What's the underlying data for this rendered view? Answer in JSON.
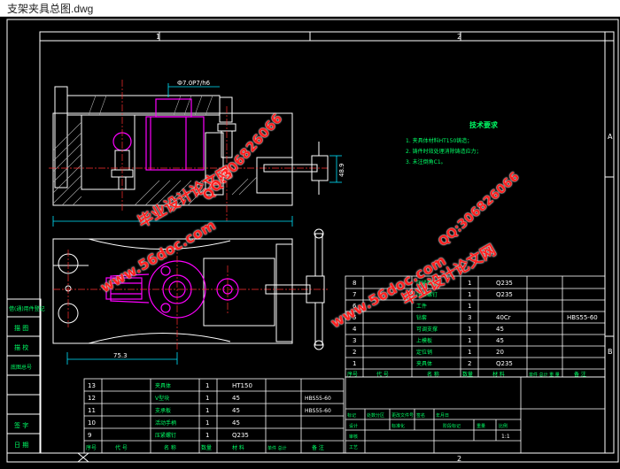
{
  "window": {
    "title": "支架夹具总图.dwg"
  },
  "drawing": {
    "zone_top_1": "1",
    "zone_top_2": "2",
    "zone_bottom_2": "2",
    "zone_right_a": "A",
    "zone_right_b": "B",
    "dim_fit": "Ф7.0P7/h6",
    "dim_height": "48.9",
    "dim_length": "75.3",
    "tech_title": "技术要求",
    "tech_items": [
      "1. 夹具体材料HT150铸造；",
      "2. 铸件时效处理消除铸造应力；",
      "3. 未注倒角C1。"
    ],
    "left_labels": [
      "借(通)用件登记",
      "描 图",
      "描 校",
      "底图总号",
      "签 字",
      "日 期"
    ]
  },
  "parts_upper": {
    "rows": [
      {
        "no": "8",
        "code": "",
        "name": "压紧螺母",
        "qty": "1",
        "material": "Q235",
        "note": ""
      },
      {
        "no": "7",
        "code": "",
        "name": "压紧螺钉",
        "qty": "1",
        "material": "Q235",
        "note": ""
      },
      {
        "no": "6",
        "code": "",
        "name": "工件",
        "qty": "1",
        "material": "",
        "note": ""
      },
      {
        "no": "5",
        "code": "",
        "name": "钻套",
        "qty": "3",
        "material": "40Cr",
        "note": "HBS55-60"
      },
      {
        "no": "4",
        "code": "",
        "name": "可调支撑",
        "qty": "1",
        "material": "45",
        "note": ""
      },
      {
        "no": "3",
        "code": "",
        "name": "上模板",
        "qty": "1",
        "material": "45",
        "note": ""
      },
      {
        "no": "2",
        "code": "",
        "name": "定位销",
        "qty": "1",
        "material": "20",
        "note": ""
      },
      {
        "no": "1",
        "code": "",
        "name": "夹具体",
        "qty": "2",
        "material": "Q235",
        "note": ""
      }
    ],
    "header": {
      "no": "序号",
      "code": "代 号",
      "name": "名 称",
      "qty": "数量",
      "material": "材 料",
      "weight": "单件 总计 重 量",
      "note": "备 注"
    }
  },
  "parts_lower": {
    "rows": [
      {
        "no": "13",
        "name": "夹具体",
        "qty": "1",
        "material": "HT150",
        "note": ""
      },
      {
        "no": "12",
        "name": "V型块",
        "qty": "1",
        "material": "45",
        "note": "HBS55-60"
      },
      {
        "no": "11",
        "name": "支承板",
        "qty": "1",
        "material": "45",
        "note": "HBS55-60"
      },
      {
        "no": "10",
        "name": "活动手柄",
        "qty": "1",
        "material": "45",
        "note": ""
      },
      {
        "no": "9",
        "name": "压紧螺钉",
        "qty": "1",
        "material": "Q235",
        "note": ""
      }
    ],
    "header": {
      "no": "序号",
      "code": "代 号",
      "name": "名 称",
      "qty": "数量",
      "material": "材 料",
      "weight": "单件 总计",
      "note": "备 注"
    }
  },
  "title_block": {
    "mark": "标记",
    "count": "处数",
    "zone": "分区",
    "change_doc": "更改文件号",
    "signature": "签名",
    "date": "年月日",
    "design": "设计",
    "standard": "标准化",
    "stage": "阶段标记",
    "weight": "重量",
    "scale": "比例",
    "scale_value": "1:1",
    "review": "审核",
    "process": "工艺"
  },
  "watermarks": [
    {
      "text": "毕业设计论文网",
      "color": "#ff2020"
    },
    {
      "text": "www.56doc.com",
      "color": "#ff2020"
    },
    {
      "text": "QQ:306826066",
      "color": "#ff2020"
    },
    {
      "text": "QQ:306826066",
      "color": "#ff2020"
    },
    {
      "text": "www.56doc.com",
      "color": "#ff2020"
    },
    {
      "text": "毕业设计论文网",
      "color": "#ff2020"
    }
  ],
  "colors": {
    "line": "#ffffff",
    "part": "#ff00ff",
    "center": "#ff3030",
    "dim": "#00e5ff",
    "note": "#00ff66",
    "bg": "#000000"
  }
}
